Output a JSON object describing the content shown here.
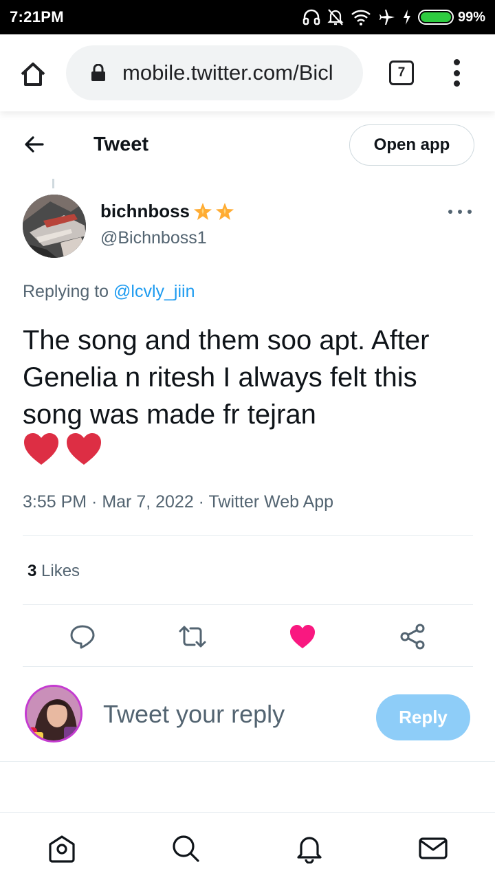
{
  "status_bar": {
    "time": "7:21PM",
    "battery_percent": "99%",
    "battery_level": 0.99,
    "icons": [
      "headphones-icon",
      "mute-bell-icon",
      "wifi-icon",
      "airplane-icon",
      "charging-icon",
      "battery-icon"
    ]
  },
  "browser": {
    "url": "mobile.twitter.com/Bicl",
    "tab_count": "7"
  },
  "header": {
    "title": "Tweet",
    "open_app_label": "Open app"
  },
  "tweet": {
    "author_name": "bichnboss",
    "author_handle": "@Bichnboss1",
    "replying_prefix": "Replying to ",
    "replying_to": "@lcvly_jiin",
    "text": "The song and them soo apt. After Genelia n ritesh I always felt this song was made fr tejran",
    "emoji_hearts": 2,
    "timestamp": "3:55 PM · Mar 7, 2022 · Twitter Web App",
    "likes_count": "3",
    "likes_label": " Likes"
  },
  "reply": {
    "placeholder": "Tweet your reply",
    "button_label": "Reply"
  },
  "colors": {
    "accent": "#1d9bf0",
    "like_active": "#f91880",
    "reply_button_disabled": "#8ecdf8",
    "secondary_text": "#536471"
  }
}
